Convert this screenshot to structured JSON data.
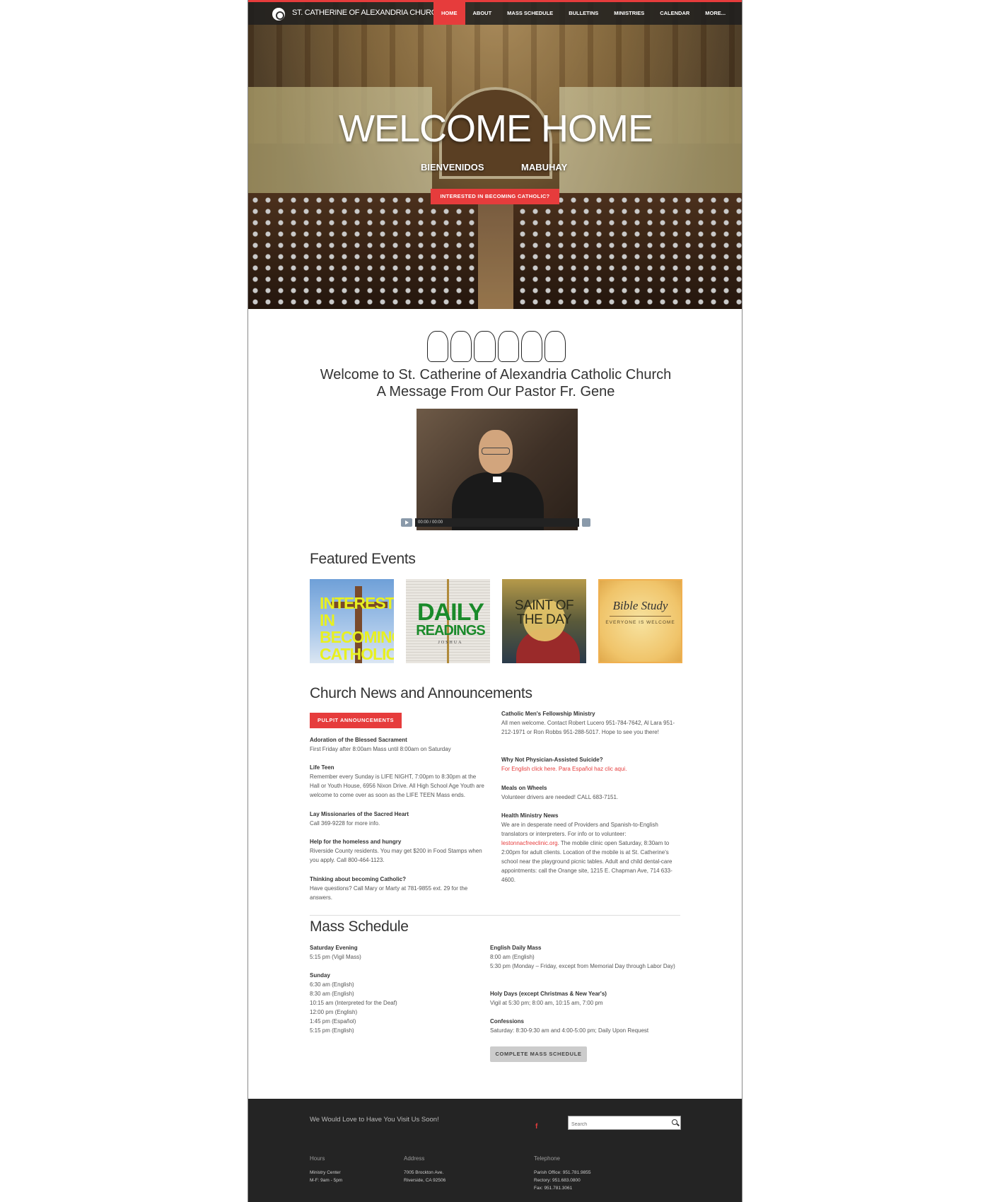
{
  "nav": {
    "brand": "ST. CATHERINE OF ALEXANDRIA CHURCH",
    "items": [
      "HOME",
      "ABOUT",
      "MASS SCHEDULE",
      "BULLETINS",
      "MINISTRIES",
      "CALENDAR",
      "MORE..."
    ],
    "active": "HOME"
  },
  "hero": {
    "title": "WELCOME HOME",
    "sub_left": "BIENVENIDOS",
    "sub_right": "MABUHAY",
    "button": "INTERESTED IN BECOMING CATHOLIC?"
  },
  "welcome": {
    "line1": "Welcome to St. Catherine of Alexandria Catholic Church",
    "line2": "A Message From Our Pastor Fr. Gene"
  },
  "video": {
    "time": "00:00 / 00:00"
  },
  "featured": {
    "title": "Featured Events",
    "cards": [
      {
        "text": "INTERESTED IN BECOMING CATHOLIC"
      },
      {
        "line1": "DAILY",
        "line2": "READINGS",
        "line3": "JOSHUA"
      },
      {
        "text": "SAINT OF THE DAY"
      },
      {
        "title": "Bible Study",
        "sub": "EVERYONE IS WELCOME"
      }
    ]
  },
  "news": {
    "title": "Church News and Announcements",
    "button": "PULPIT ANNOUNCEMENTS",
    "left": [
      {
        "h": "Adoration of the Blessed Sacrament",
        "t": "First Friday after 8:00am Mass until 8:00am on Saturday"
      },
      {
        "h": "Life Teen",
        "t": "Remember every Sunday is LIFE NIGHT, 7:00pm to 8:30pm at the Hall or Youth House, 6956 Nixon Drive. All High School Age Youth are welcome to come over as soon as the LIFE TEEN Mass ends."
      },
      {
        "h": "Lay Missionaries of the Sacred Heart",
        "t": "Call 369-9228 for more info."
      },
      {
        "h": "Help for the homeless and hungry",
        "t": "Riverside County residents. You may get $200 in Food Stamps when you apply. Call 800-464-1123."
      },
      {
        "h": "Thinking about becoming Catholic?",
        "t": "Have questions? Call Mary or Marty at 781-9855 ext. 29 for the answers."
      }
    ],
    "right": [
      {
        "h": "Catholic Men's Fellowship Ministry",
        "t": "All men welcome. Contact Robert Lucero 951-784-7642, Al Lara 951-212-1971 or Ron Robbs 951-288-5017. Hope to see you there!"
      },
      {
        "h": "Why Not Physician-Assisted Suicide?",
        "link": "For English click here. Para Español haz clic aqui."
      },
      {
        "h": "Meals on Wheels",
        "t": "Volunteer drivers are needed! CALL 683-7151."
      },
      {
        "h": "Health Ministry News",
        "t1": "We are in desperate need of Providers and Spanish-to-English translators or interpreters. For info or to volunteer: ",
        "link": "lestonnacfreeclinic.org",
        "t2": ". The mobile clinic open Saturday, 8:30am to 2:00pm for adult clients. Location of the mobile is at St. Catherine's school near the playground picnic tables. Adult and child dental-care appointments: call the Orange site, 1215 E. Chapman Ave, 714 633-4600."
      }
    ]
  },
  "mass": {
    "title": "Mass Schedule",
    "left": [
      {
        "h": "Saturday Evening",
        "lines": [
          "5:15 pm (Vigil Mass)"
        ]
      },
      {
        "h": "Sunday",
        "lines": [
          "6:30 am (English)",
          "8:30 am (English)",
          "10:15 am (Interpreted for the Deaf)",
          "12:00 pm (English)",
          "1:45 pm (Español)",
          "5:15 pm (English)"
        ]
      }
    ],
    "right": [
      {
        "h": "English Daily Mass",
        "lines": [
          "8:00 am (English)",
          "5:30 pm (Monday – Friday, except from Memorial Day through Labor Day)"
        ]
      },
      {
        "h": "Holy Days (except Christmas & New Year's)",
        "lines": [
          "Vigil at 5:30 pm; 8:00 am, 10:15 am, 7:00 pm"
        ]
      },
      {
        "h": "Confessions",
        "lines": [
          "Saturday: 8:30-9:30 am and 4:00-5:00 pm; Daily Upon Request"
        ]
      }
    ],
    "button": "COMPLETE MASS SCHEDULE"
  },
  "footer": {
    "tagline": "We Would Love to Have You Visit Us Soon!",
    "fb": "f",
    "search_placeholder": "Search",
    "hours_h": "Hours",
    "hours": [
      "Ministry Center",
      "M-F: 9am - 5pm"
    ],
    "address_h": "Address",
    "address": [
      "7005 Brockton Ave.",
      "Riverside, CA 92506"
    ],
    "phone_h": "Telephone",
    "phone": [
      "Parish Office: 951.781.9855",
      "Rectory: 951.683.0800",
      "Fax: 951.781.3061"
    ]
  }
}
